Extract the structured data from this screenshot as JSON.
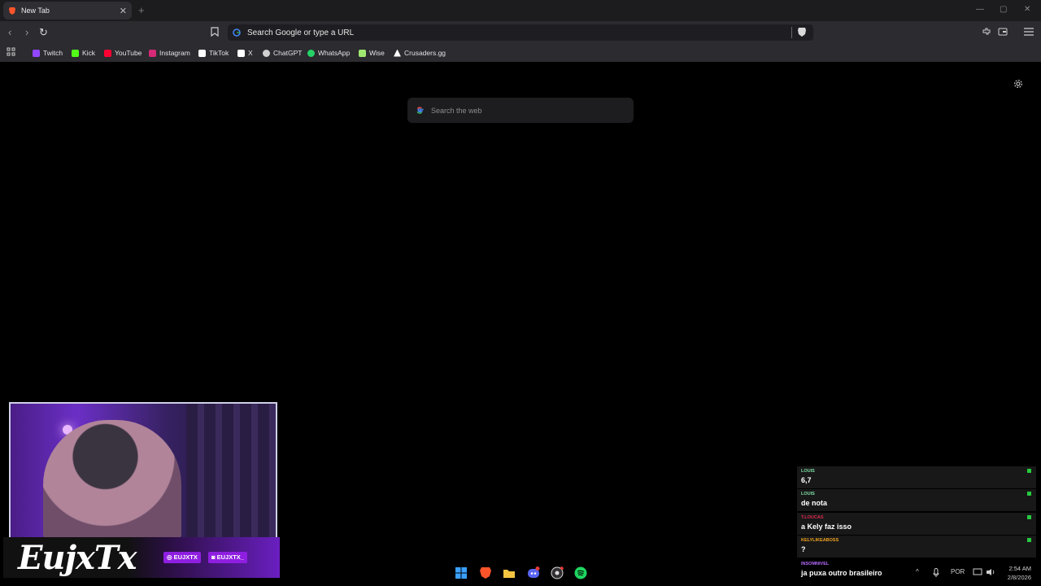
{
  "tab": {
    "title": "New Tab",
    "close": "✕",
    "new_tab": "+"
  },
  "window": {
    "minimize": "—",
    "maximize": "▢",
    "close": "✕"
  },
  "toolbar": {
    "back": "‹",
    "forward": "›",
    "reload": "↻",
    "omnibox_placeholder": "Search Google or type a URL"
  },
  "bookmarks": [
    {
      "label": "Twitch",
      "icon": "twitch-icon",
      "color": "#9146ff"
    },
    {
      "label": "Kick",
      "icon": "kick-icon",
      "color": "#53fc18"
    },
    {
      "label": "YouTube",
      "icon": "youtube-icon",
      "color": "#ff0033"
    },
    {
      "label": "Instagram",
      "icon": "instagram-icon",
      "color": "#d62976"
    },
    {
      "label": "TikTok",
      "icon": "tiktok-icon",
      "color": "#ffffff"
    },
    {
      "label": "X",
      "icon": "x-icon",
      "color": "#ffffff"
    },
    {
      "label": "ChatGPT",
      "icon": "chatgpt-icon",
      "color": "#d0d0d0"
    },
    {
      "label": "WhatsApp",
      "icon": "whatsapp-icon",
      "color": "#25d366"
    },
    {
      "label": "Wise",
      "icon": "wise-icon",
      "color": "#9fe870"
    },
    {
      "label": "Crusaders.gg",
      "icon": "crusaders-icon",
      "color": "#ffffff"
    }
  ],
  "page": {
    "search_placeholder": "Search the web"
  },
  "stream": {
    "logo": "EujxTx",
    "tag_instagram": "EUJXTX",
    "tag_twitch": "EUJXTX_"
  },
  "chat": [
    {
      "user": "LOUIS",
      "message": "6,7",
      "user_color": "#7fe0a8"
    },
    {
      "user": "LOUIS",
      "message": "de nota",
      "user_color": "#7fe0a8"
    },
    {
      "user": "T.LOUCAS",
      "message": "a Kely faz isso",
      "user_color": "#e0294f"
    },
    {
      "user": "KELYLIKEABOSS",
      "message": "?",
      "user_color": "#f2a31f"
    },
    {
      "user": "INSOMNIVEL",
      "message": "ja puxa outro brasileiro",
      "user_color": "#b66bff"
    }
  ],
  "tray": {
    "language": "POR",
    "time": "2:54 AM",
    "date": "2/8/2026"
  }
}
